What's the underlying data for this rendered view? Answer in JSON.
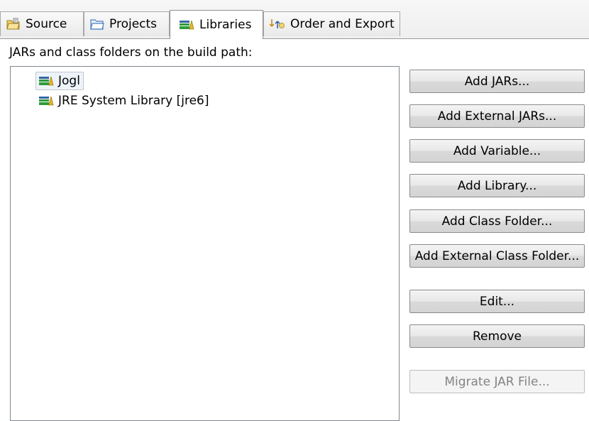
{
  "tabs": [
    {
      "label": "Source",
      "icon": "source-folder-icon",
      "active": false
    },
    {
      "label": "Projects",
      "icon": "projects-folder-icon",
      "active": false
    },
    {
      "label": "Libraries",
      "icon": "library-books-icon",
      "active": true
    },
    {
      "label": "Order and Export",
      "icon": "order-export-icon",
      "active": false
    }
  ],
  "build_path": {
    "heading": "JARs and class folders on the build path:",
    "items": [
      {
        "label": "Jogl",
        "icon": "library-books-icon",
        "selected": true
      },
      {
        "label": "JRE System Library [jre6]",
        "icon": "library-books-icon",
        "selected": false
      }
    ]
  },
  "buttons": {
    "add_jars": "Add JARs...",
    "add_external_jars": "Add External JARs...",
    "add_variable": "Add Variable...",
    "add_library": "Add Library...",
    "add_class_folder": "Add Class Folder...",
    "add_external_class_folder": "Add External Class Folder...",
    "edit": "Edit...",
    "remove": "Remove",
    "migrate_jar": "Migrate JAR File..."
  },
  "colors": {
    "library_green": "#2e9b3a",
    "library_yellow": "#e8b923",
    "library_blue": "#3465a4",
    "folder_yellow": "#f2d46b",
    "project_blue": "#4a7fc1"
  }
}
